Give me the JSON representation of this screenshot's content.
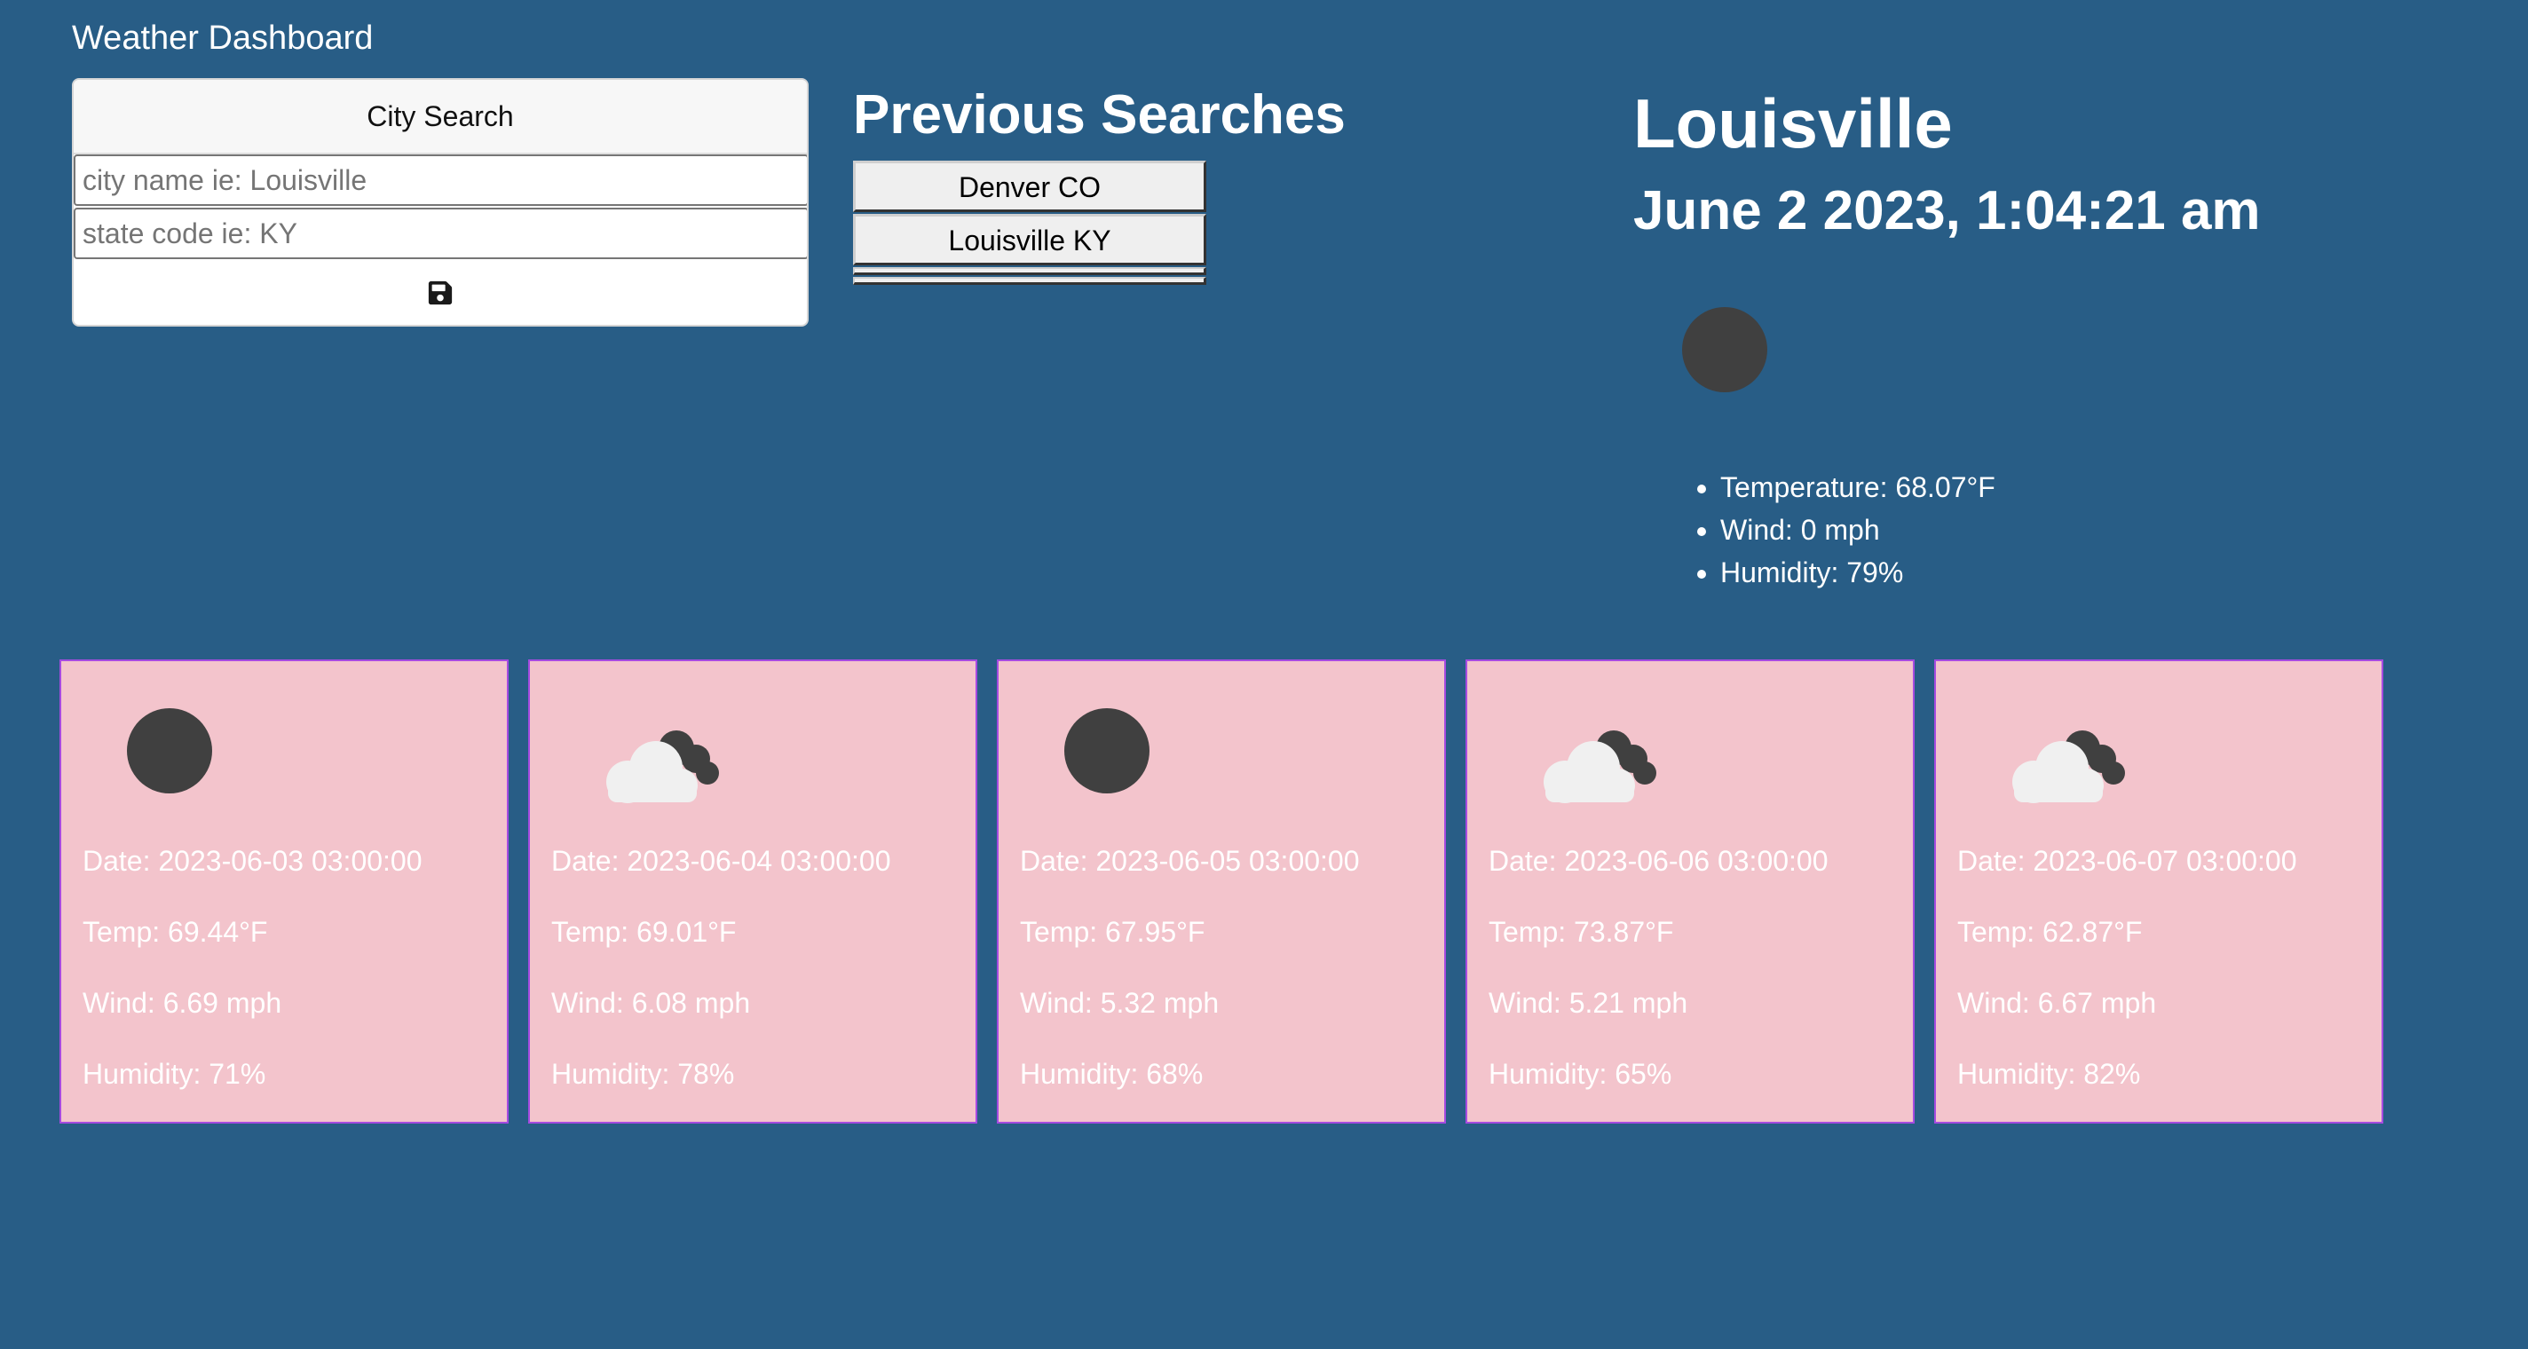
{
  "app": {
    "title": "Weather Dashboard"
  },
  "search": {
    "header": "City Search",
    "city_placeholder": "city name ie: Louisville",
    "state_placeholder": "state code ie: KY",
    "save_icon": "floppy-disk-icon"
  },
  "previous": {
    "title": "Previous Searches",
    "items": [
      "Denver CO",
      "Louisville KY"
    ]
  },
  "current": {
    "city": "Louisville",
    "datetime": "June 2 2023, 1:04:21 am",
    "icon": "moon-icon",
    "details": [
      "Temperature: 68.07°F",
      "Wind: 0 mph",
      "Humidity: 79%"
    ]
  },
  "forecast": [
    {
      "icon": "moon-icon",
      "date": "Date: 2023-06-03 03:00:00",
      "temp": "Temp: 69.44°F",
      "wind": "Wind: 6.69 mph",
      "humidity": "Humidity: 71%"
    },
    {
      "icon": "cloudy-night-icon",
      "date": "Date: 2023-06-04 03:00:00",
      "temp": "Temp: 69.01°F",
      "wind": "Wind: 6.08 mph",
      "humidity": "Humidity: 78%"
    },
    {
      "icon": "moon-icon",
      "date": "Date: 2023-06-05 03:00:00",
      "temp": "Temp: 67.95°F",
      "wind": "Wind: 5.32 mph",
      "humidity": "Humidity: 68%"
    },
    {
      "icon": "cloudy-night-icon",
      "date": "Date: 2023-06-06 03:00:00",
      "temp": "Temp: 73.87°F",
      "wind": "Wind: 5.21 mph",
      "humidity": "Humidity: 65%"
    },
    {
      "icon": "cloudy-night-icon",
      "date": "Date: 2023-06-07 03:00:00",
      "temp": "Temp: 62.87°F",
      "wind": "Wind: 6.67 mph",
      "humidity": "Humidity: 82%"
    }
  ],
  "colors": {
    "background": "#285d86",
    "card": "#f3c4cc",
    "card_border": "#a54be0",
    "moon": "#404040",
    "cloud": "#f0f0f0"
  }
}
